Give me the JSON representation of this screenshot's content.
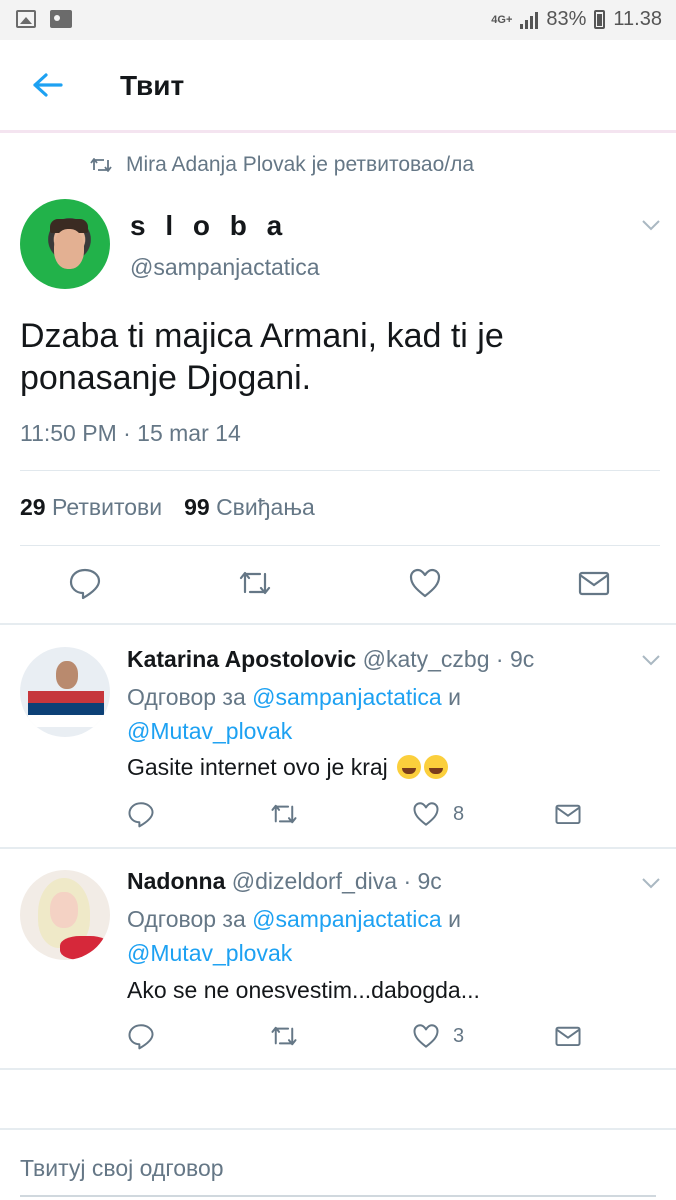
{
  "status_bar": {
    "network": "4G+",
    "battery": "83%",
    "time": "11.38",
    "icons": [
      "image-icon",
      "card-icon",
      "signal-icon",
      "battery-icon"
    ]
  },
  "header": {
    "title": "Твит",
    "back_icon": "arrow-left-icon"
  },
  "retweet_context": {
    "text": "Mira Adanja Plovak je ретвитовао/ла",
    "icon": "retweet-icon"
  },
  "tweet": {
    "name": "s l o b a",
    "handle": "@sampanjactatica",
    "text": "Dzaba ti majica Armani, kad ti je ponasanje Djogani.",
    "time": "11:50 PM · 15 mar 14",
    "retweets_count": "29",
    "retweets_label": "Ретвитови",
    "likes_count": "99",
    "likes_label": "Свиђања",
    "actions": [
      "reply-icon",
      "retweet-icon",
      "heart-icon",
      "message-icon"
    ]
  },
  "replies": [
    {
      "name": "Katarina Apostolovic",
      "handle": "@katy_czbg · 9c",
      "reply_prefix": "Одговор за",
      "mention1": "@sampanjactatica",
      "conj": "и",
      "mention2": "@Mutav_plovak",
      "text": "Gasite internet ovo je kraj",
      "likes": "8"
    },
    {
      "name": "Nadonna",
      "handle": "@dizeldorf_diva · 9c",
      "reply_prefix": "Одговор за",
      "mention1": "@sampanjactatica",
      "conj": "и",
      "mention2": "@Mutav_plovak",
      "text": "Ako se ne onesvestim...dabogda...",
      "likes": "3"
    }
  ],
  "compose": {
    "placeholder": "Твитуј свој одговор"
  },
  "colors": {
    "accent": "#1da1f2",
    "secondary_text": "#657786",
    "primary_text": "#14171a",
    "divider": "#e6ecf0"
  }
}
